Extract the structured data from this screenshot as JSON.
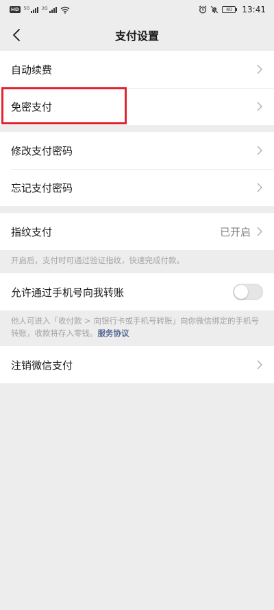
{
  "status_bar": {
    "hd_badge": "HD",
    "net1": "5G",
    "net2": "2G",
    "battery": "40",
    "time": "13:41"
  },
  "nav": {
    "title": "支付设置"
  },
  "sections": {
    "auto_renew": {
      "label": "自动续费"
    },
    "password_free": {
      "label": "免密支付"
    },
    "change_password": {
      "label": "修改支付密码"
    },
    "forgot_password": {
      "label": "忘记支付密码"
    },
    "fingerprint": {
      "label": "指纹支付",
      "value": "已开启",
      "note": "开启后，支付时可通过验证指纹，快速完成付款。"
    },
    "phone_transfer": {
      "label": "允许通过手机号向我转账",
      "toggle_on": false,
      "note": "他人可进入「收付款 > 向银行卡或手机号转账」向你微信绑定的手机号转账，收款将存入零钱。",
      "note_link": "服务协议"
    },
    "deregister": {
      "label": "注销微信支付"
    }
  },
  "colors": {
    "background": "#ededed",
    "link": "#576b95",
    "highlight": "#e1232f"
  }
}
